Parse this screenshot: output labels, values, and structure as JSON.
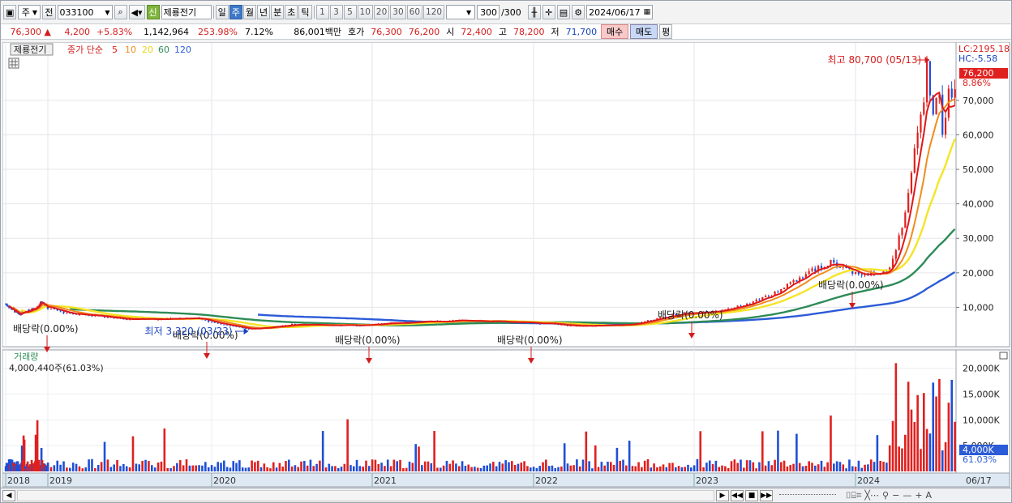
{
  "toolbar": {
    "period_type": "주",
    "prev_label": "전",
    "code": "033100",
    "new_badge": "신",
    "stock_name": "제룡전기",
    "periods": [
      "일",
      "주",
      "월",
      "년",
      "분",
      "초",
      "틱"
    ],
    "active_period": "주",
    "intervals": [
      "1",
      "3",
      "5",
      "10",
      "20",
      "30",
      "60",
      "120"
    ],
    "count": "300",
    "count_total": "/300",
    "date": "2024/06/17"
  },
  "quote": {
    "price": "76,300",
    "change_arrow": "▲",
    "change": "4,200",
    "change_pct": "+5.83%",
    "volume": "1,142,964",
    "vol_ratio": "253.98%",
    "turnover": "7.12%",
    "amount": "86,001백만",
    "ask_label": "호가",
    "ask": "76,300",
    "bid": "76,200",
    "open_label": "시",
    "open": "72,400",
    "high_label": "고",
    "high": "78,200",
    "low_label": "저",
    "low": "71,700",
    "buy_label": "매수",
    "sell_label": "매도",
    "avg_label": "평"
  },
  "legend": {
    "name": "제룡전기",
    "ma_title": "종가 단순",
    "ma_periods": [
      "5",
      "10",
      "20",
      "60",
      "120"
    ]
  },
  "right_axis": {
    "lc": "LC:2195.18",
    "hc": "HC:-5.58",
    "current": "76,200",
    "current_pct": "8.86%",
    "ticks": [
      "70,000",
      "60,000",
      "50,000",
      "40,000",
      "30,000",
      "20,000",
      "10,000"
    ]
  },
  "annotations": {
    "high": "최고 80,700 (05/13)",
    "low": "최저 3,320 (03/23)",
    "dividend": "배당락(0.00%)"
  },
  "volume": {
    "title": "거래량",
    "value": "4,000,440주(61.03%)",
    "ticks": [
      "20,000K",
      "15,000K",
      "10,000K",
      "5,000K"
    ],
    "current": "4,000K",
    "current_pct": "61.03%"
  },
  "x_axis": [
    "2018",
    "2019",
    "2020",
    "2021",
    "2022",
    "2023",
    "2024",
    "06/17"
  ],
  "colors": {
    "up": "#e0201e",
    "down": "#1f4fd6",
    "ma5": "#e01818",
    "ma10": "#f08c1e",
    "ma20": "#f5e426",
    "ma60": "#2e8b57",
    "ma120": "#2b5bd7"
  },
  "chart_data": {
    "type": "line",
    "title": "제룡전기",
    "ylim": [
      0,
      85000
    ],
    "x": [
      "2018",
      "2019",
      "2020",
      "2021",
      "2022",
      "2023",
      "2024",
      "06/17"
    ],
    "series": [
      {
        "name": "5",
        "values": [
          9000,
          9500,
          6000,
          5500,
          5000,
          9000,
          22000,
          70000
        ]
      },
      {
        "name": "10",
        "values": [
          9200,
          9400,
          6200,
          5600,
          5100,
          8700,
          21000,
          67000
        ]
      },
      {
        "name": "20",
        "values": [
          9300,
          9300,
          6400,
          5700,
          5200,
          8300,
          20000,
          49000
        ]
      },
      {
        "name": "60",
        "values": [
          null,
          null,
          7000,
          6200,
          5600,
          7200,
          17000,
          30500
        ]
      },
      {
        "name": "120",
        "values": [
          null,
          null,
          null,
          6500,
          6200,
          7000,
          13500,
          19800
        ]
      }
    ],
    "high": {
      "value": 80700,
      "date": "05/13"
    },
    "low": {
      "value": 3320,
      "date": "03/23"
    },
    "last": 76200
  }
}
